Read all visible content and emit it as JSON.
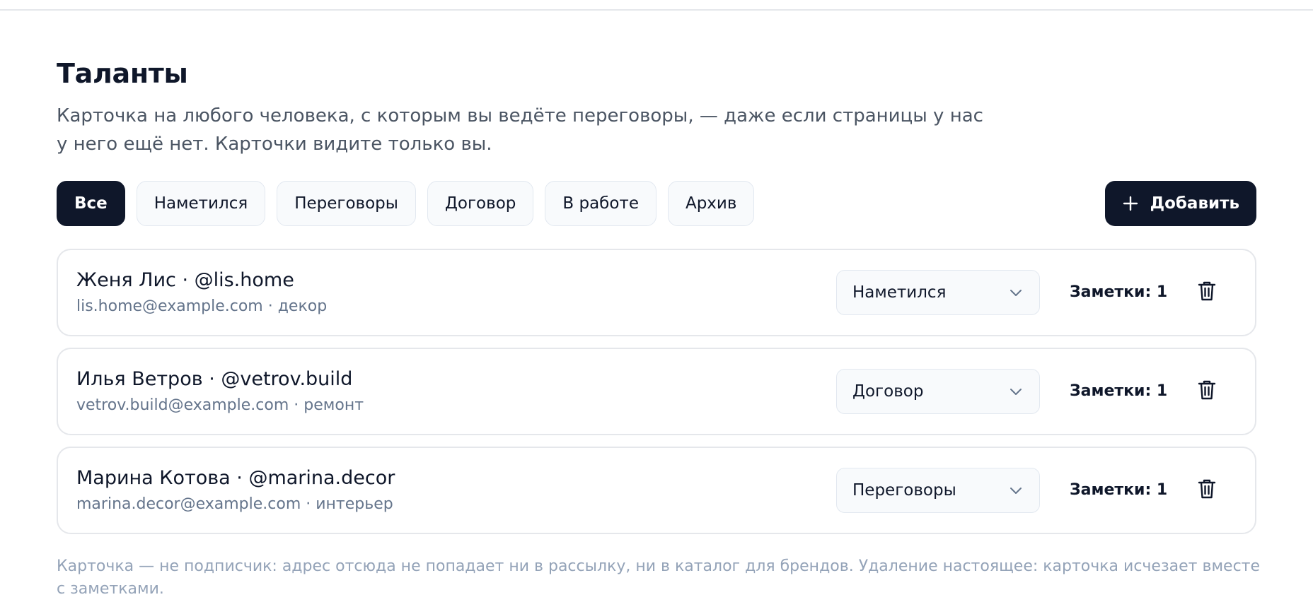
{
  "page": {
    "title": "Таланты",
    "description": "Карточка на любого человека, с которым вы ведёте переговоры, — даже если страницы у нас у него ещё нет. Карточки видите только вы.",
    "footnote": "Карточка — не подписчик: адрес отсюда не попадает ни в рассылку, ни в каталог для брендов. Удаление настоящее: карточка исчезает вместе с заметками."
  },
  "filters": [
    {
      "label": "Все",
      "active": true
    },
    {
      "label": "Наметился",
      "active": false
    },
    {
      "label": "Переговоры",
      "active": false
    },
    {
      "label": "Договор",
      "active": false
    },
    {
      "label": "В работе",
      "active": false
    },
    {
      "label": "Архив",
      "active": false
    }
  ],
  "add_button": {
    "label": "Добавить",
    "icon": "plus-icon"
  },
  "talents": [
    {
      "name": "Женя Лис · @lis.home",
      "meta": "lis.home@example.com · декор",
      "status": "Наметился",
      "notes": "Заметки: 1"
    },
    {
      "name": "Илья Ветров · @vetrov.build",
      "meta": "vetrov.build@example.com · ремонт",
      "status": "Договор",
      "notes": "Заметки: 1"
    },
    {
      "name": "Марина Котова · @marina.decor",
      "meta": "marina.decor@example.com · интерьер",
      "status": "Переговоры",
      "notes": "Заметки: 1"
    }
  ],
  "icons": {
    "select": "chevron-down-icon",
    "delete": "trash-icon"
  },
  "colors": {
    "primary": "#0f172a",
    "chip_bg": "#f8fafc",
    "border": "#e2e8f0",
    "muted_text": "#64748b",
    "footnote_text": "#94a3b8"
  }
}
